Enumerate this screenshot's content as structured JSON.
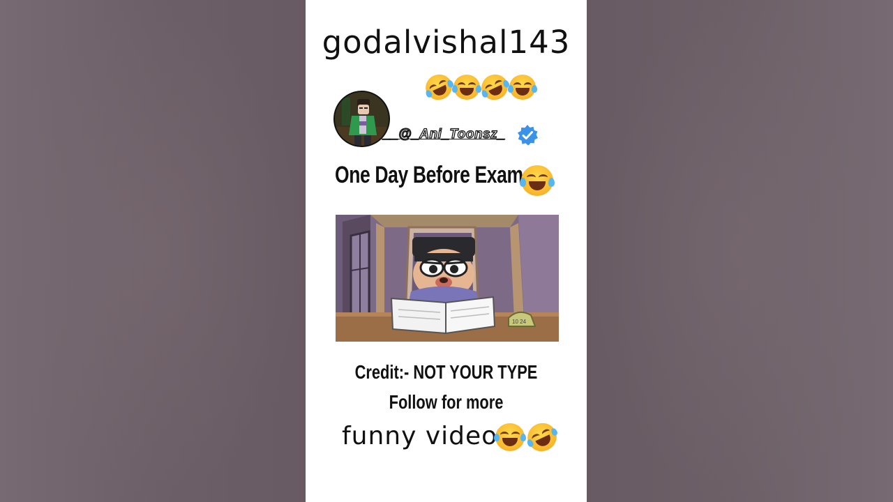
{
  "post": {
    "username": "godalvishal143",
    "handle": "__@_Ani_Toonsz_",
    "headline": "One Day Before Exam",
    "credit": "Credit:- NOT YOUR TYPE",
    "follow": "Follow for more",
    "caption": "funny video"
  },
  "emojis": {
    "top_row": [
      "rolling-on-floor-laughing-emoji",
      "tears-of-joy-emoji",
      "rolling-on-floor-laughing-emoji",
      "tears-of-joy-emoji"
    ],
    "headline": "tears-of-joy-emoji",
    "caption": [
      "tears-of-joy-emoji",
      "rolling-on-floor-laughing-emoji"
    ]
  },
  "colors": {
    "panel": "#ffffff",
    "background": "#6a5c64",
    "verified": "#3a93e8",
    "emoji": "#f9b62b"
  },
  "illustration": {
    "clock_text": "10 24"
  }
}
